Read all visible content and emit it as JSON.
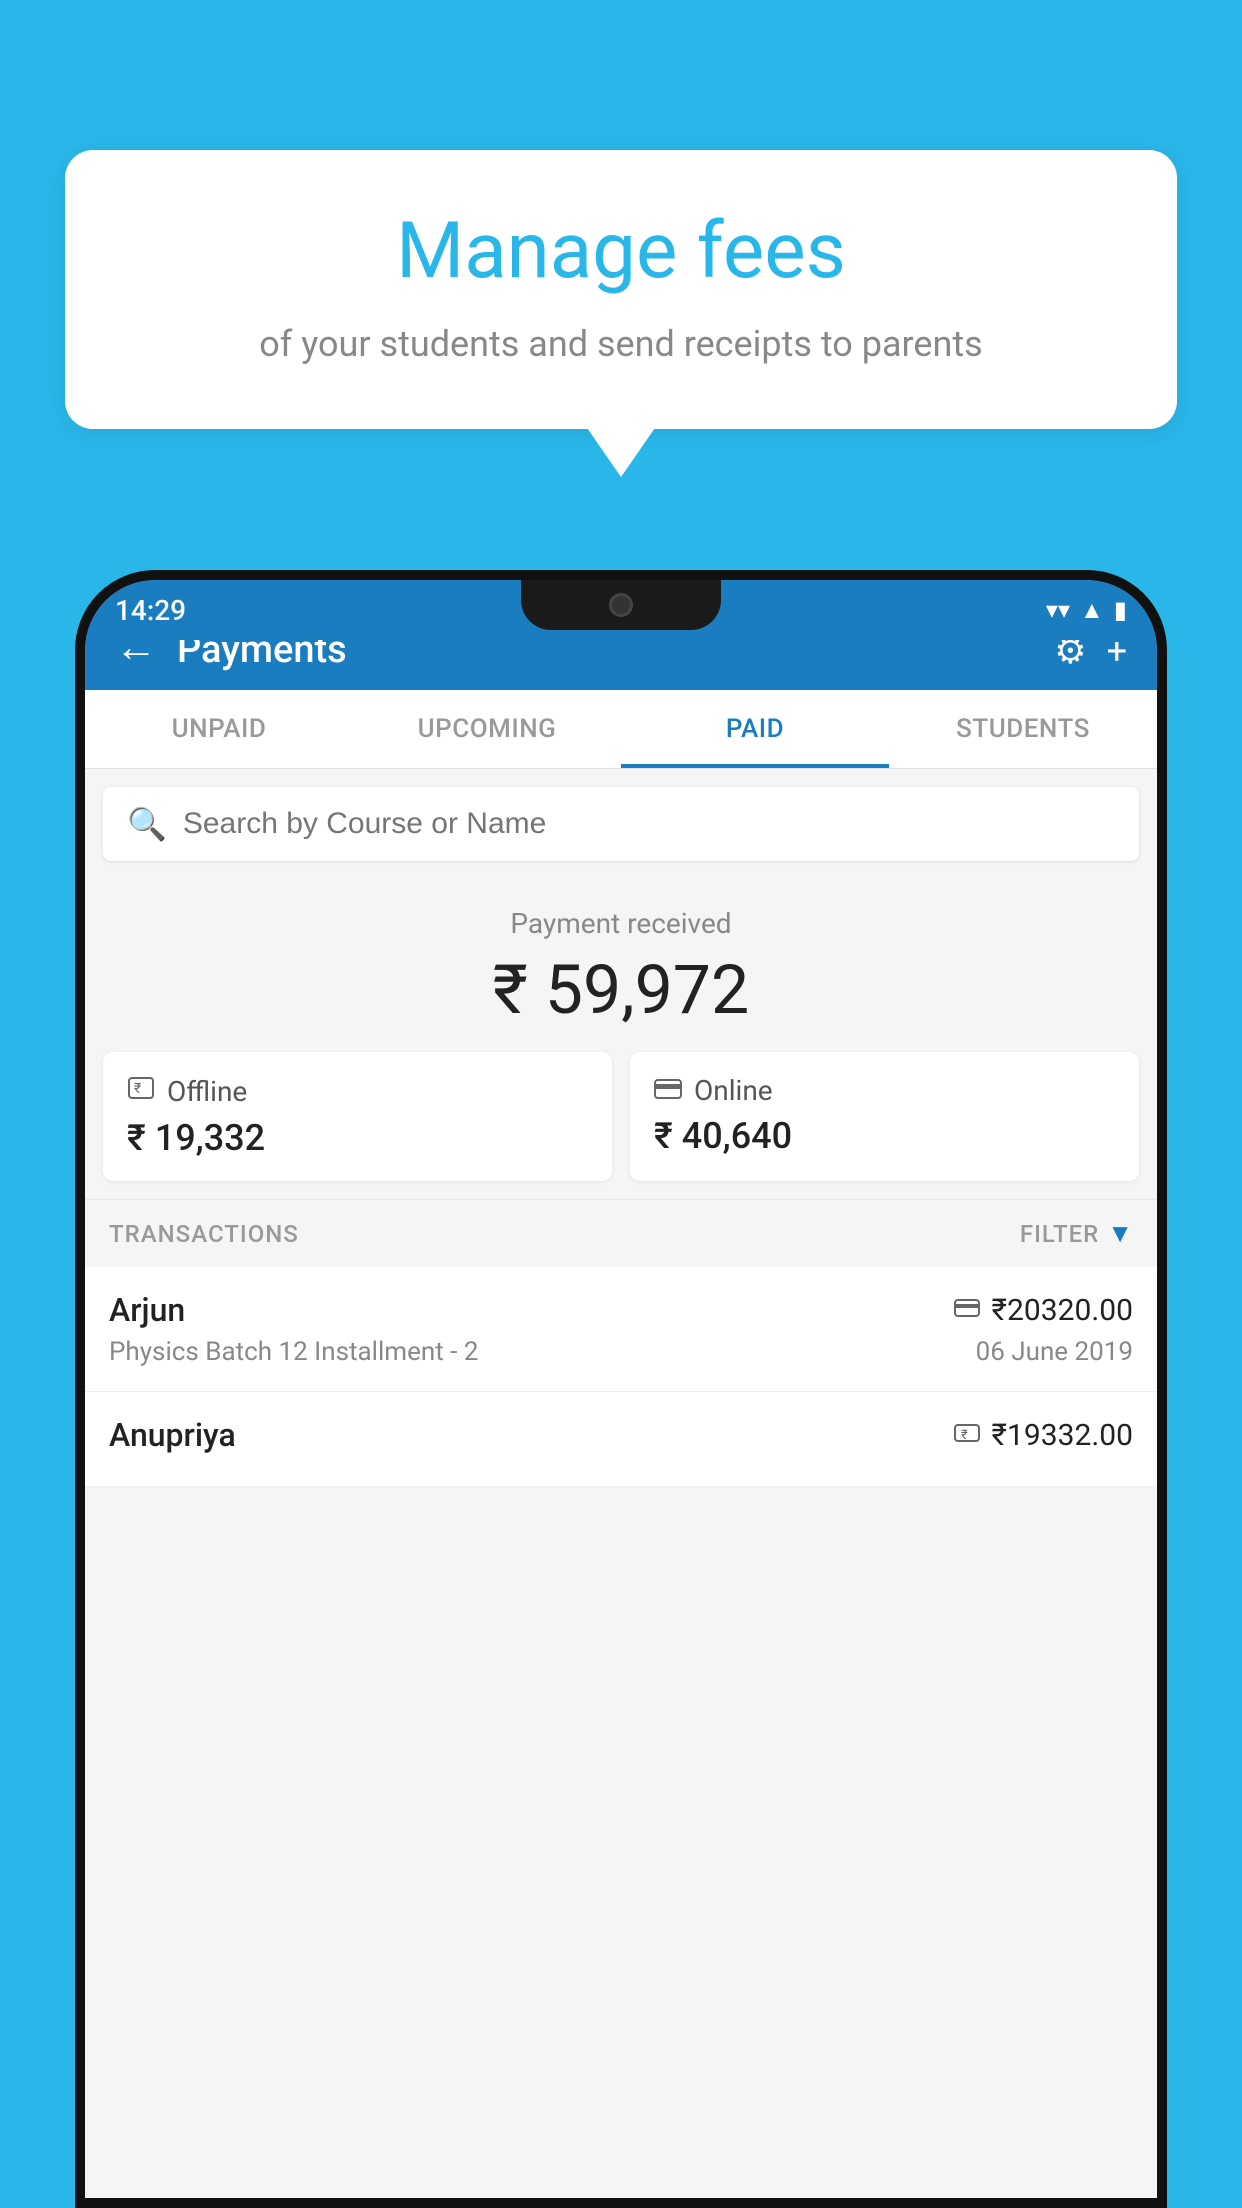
{
  "background_color": "#29b6e8",
  "bubble": {
    "title": "Manage fees",
    "subtitle": "of your students and send receipts to parents"
  },
  "status_bar": {
    "time": "14:29",
    "wifi_icon": "▼",
    "signal_icon": "▲",
    "battery_icon": "▮"
  },
  "app_bar": {
    "title": "Payments",
    "back_label": "←",
    "gear_label": "⚙",
    "plus_label": "+"
  },
  "tabs": [
    {
      "label": "UNPAID",
      "active": false
    },
    {
      "label": "UPCOMING",
      "active": false
    },
    {
      "label": "PAID",
      "active": true
    },
    {
      "label": "STUDENTS",
      "active": false
    }
  ],
  "search": {
    "placeholder": "Search by Course or Name"
  },
  "payment_received": {
    "label": "Payment received",
    "amount": "₹ 59,972"
  },
  "payment_cards": [
    {
      "type": "Offline",
      "amount": "₹ 19,332",
      "icon": "offline"
    },
    {
      "type": "Online",
      "amount": "₹ 40,640",
      "icon": "online"
    }
  ],
  "transactions_section": {
    "label": "TRANSACTIONS",
    "filter_label": "FILTER",
    "filter_icon": "▼"
  },
  "transactions": [
    {
      "name": "Arjun",
      "course": "Physics Batch 12 Installment - 2",
      "amount": "₹20320.00",
      "date": "06 June 2019",
      "payment_type": "online"
    },
    {
      "name": "Anupriya",
      "course": "",
      "amount": "₹19332.00",
      "date": "",
      "payment_type": "offline"
    }
  ]
}
